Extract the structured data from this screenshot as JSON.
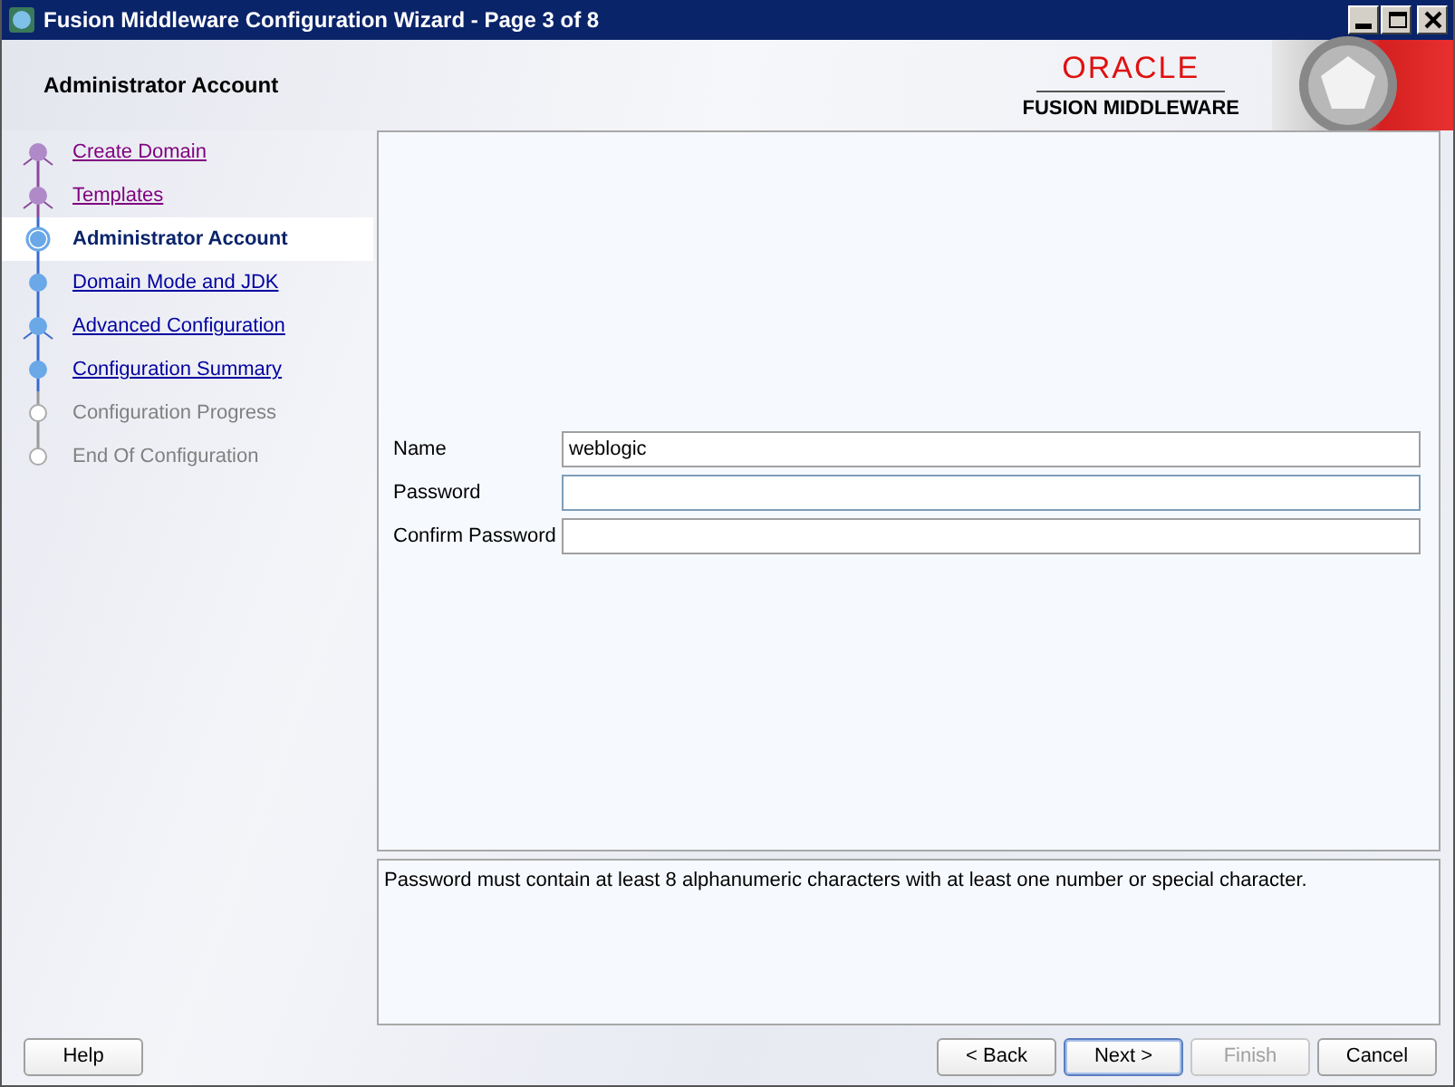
{
  "window": {
    "title": "Fusion Middleware Configuration Wizard - Page 3 of 8"
  },
  "header": {
    "title": "Administrator Account",
    "logo": "ORACLE",
    "subtitle": "FUSION MIDDLEWARE"
  },
  "steps": [
    {
      "label": "Create Domain",
      "kind": "visited",
      "fork": true
    },
    {
      "label": "Templates",
      "kind": "visited",
      "fork": true
    },
    {
      "label": "Administrator Account",
      "kind": "current",
      "fork": false
    },
    {
      "label": "Domain Mode and JDK",
      "kind": "available",
      "fork": false
    },
    {
      "label": "Advanced Configuration",
      "kind": "available",
      "fork": true
    },
    {
      "label": "Configuration Summary",
      "kind": "available",
      "fork": false
    },
    {
      "label": "Configuration Progress",
      "kind": "disabled",
      "fork": false
    },
    {
      "label": "End Of Configuration",
      "kind": "disabled",
      "fork": false
    }
  ],
  "form": {
    "fields": [
      {
        "label": "Name",
        "value": "weblogic",
        "focused": false
      },
      {
        "label": "Password",
        "focused": true
      },
      {
        "label": "Confirm Password",
        "focused": false
      }
    ]
  },
  "message": "Password must contain at least 8 alphanumeric characters with at least one number or special character.",
  "buttons": {
    "left": [
      {
        "label": "Help",
        "disabled": false,
        "default": false
      }
    ],
    "right": [
      {
        "label": "< Back",
        "disabled": false,
        "default": false
      },
      {
        "label": "Next >",
        "disabled": false,
        "default": true
      },
      {
        "label": "Finish",
        "disabled": true,
        "default": false
      },
      {
        "label": "Cancel",
        "disabled": false,
        "default": false
      }
    ]
  }
}
